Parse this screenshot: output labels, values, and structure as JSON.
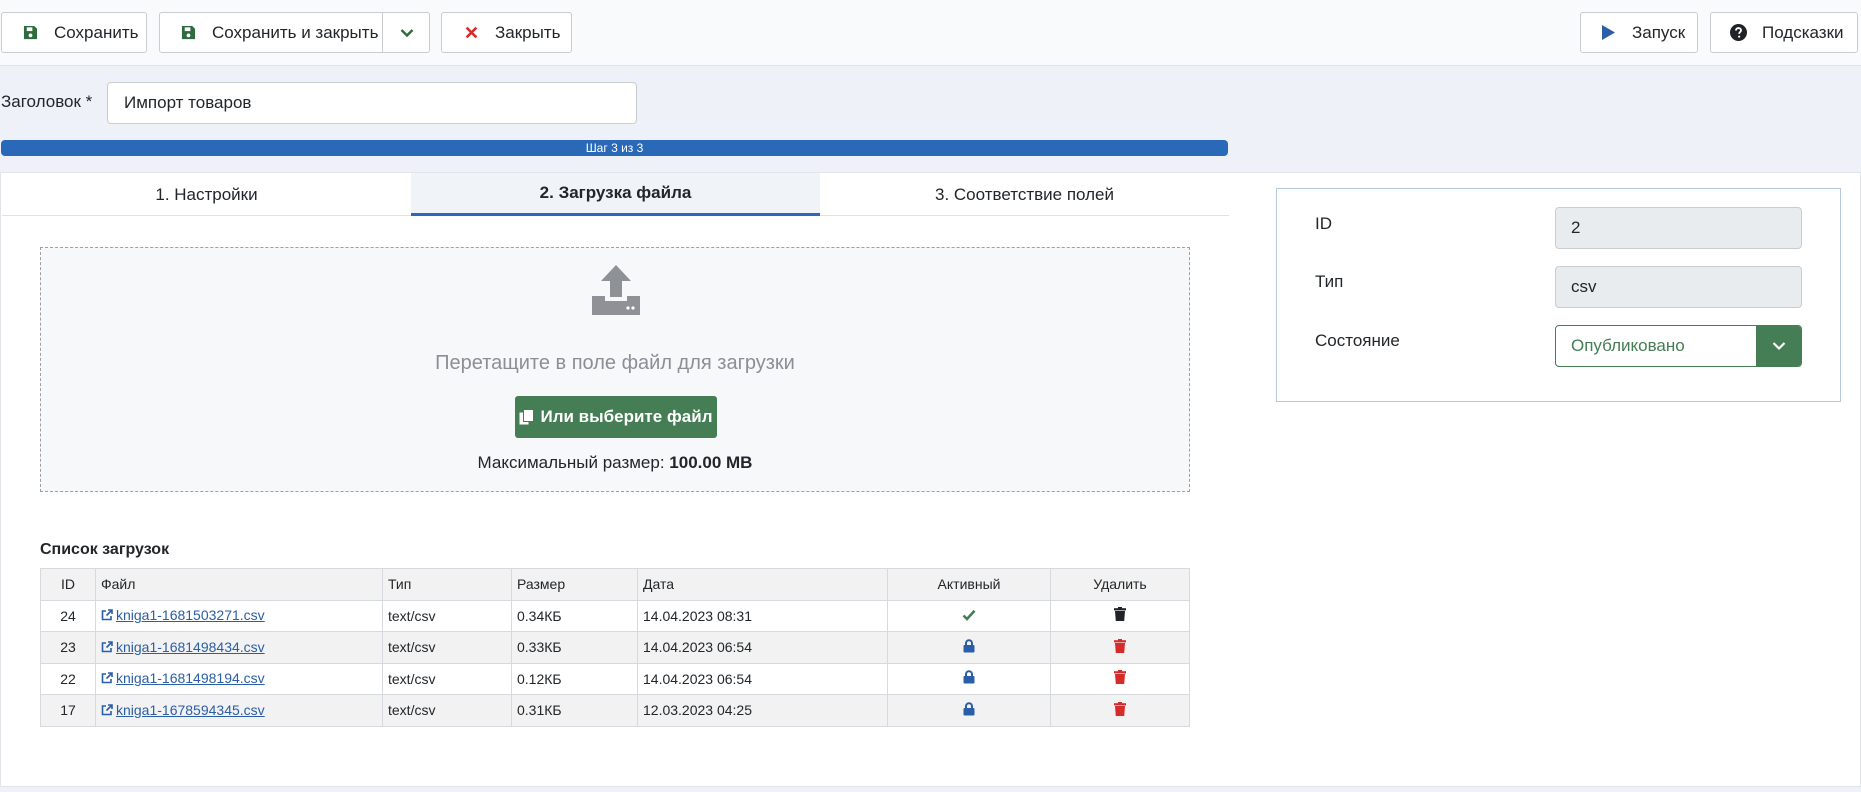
{
  "toolbar": {
    "save": "Сохранить",
    "save_close": "Сохранить и закрыть",
    "close": "Закрыть",
    "run": "Запуск",
    "hints": "Подсказки"
  },
  "title_field": {
    "label": "Заголовок *",
    "value": "Импорт товаров"
  },
  "progress": {
    "text": "Шаг 3 из 3",
    "value": 1.0
  },
  "tabs": [
    {
      "label": "1. Настройки",
      "active": false
    },
    {
      "label": "2. Загрузка файла",
      "active": true
    },
    {
      "label": "3. Соответствие полей",
      "active": false
    }
  ],
  "dropzone": {
    "text": "Перетащите в поле файл для загрузки",
    "button": "Или выберите файл",
    "max_label": "Максимальный размер: ",
    "max_value": "100.00 MB"
  },
  "uploads": {
    "title": "Список загрузок",
    "headers": {
      "id": "ID",
      "file": "Файл",
      "type": "Тип",
      "size": "Размер",
      "date": "Дата",
      "active": "Активный",
      "delete": "Удалить"
    },
    "rows": [
      {
        "id": "24",
        "file": "kniga1-1681503271.csv",
        "type": "text/csv",
        "size": "0.34КБ",
        "date": "14.04.2023 08:31",
        "active": "check-icon",
        "delete_color": "#1f2328"
      },
      {
        "id": "23",
        "file": "kniga1-1681498434.csv",
        "type": "text/csv",
        "size": "0.33КБ",
        "date": "14.04.2023 06:54",
        "active": "lock-icon",
        "delete_color": "#d52b2b"
      },
      {
        "id": "22",
        "file": "kniga1-1681498194.csv",
        "type": "text/csv",
        "size": "0.12КБ",
        "date": "14.04.2023 06:54",
        "active": "lock-icon",
        "delete_color": "#d52b2b"
      },
      {
        "id": "17",
        "file": "kniga1-1678594345.csv",
        "type": "text/csv",
        "size": "0.31КБ",
        "date": "12.03.2023 04:25",
        "active": "lock-icon",
        "delete_color": "#d52b2b"
      }
    ]
  },
  "side": {
    "id_label": "ID",
    "id_value": "2",
    "type_label": "Тип",
    "type_value": "csv",
    "state_label": "Состояние",
    "state_value": "Опубликовано"
  },
  "colors": {
    "primary": "#2a69b8",
    "success": "#457d54",
    "danger": "#d52b2b"
  }
}
